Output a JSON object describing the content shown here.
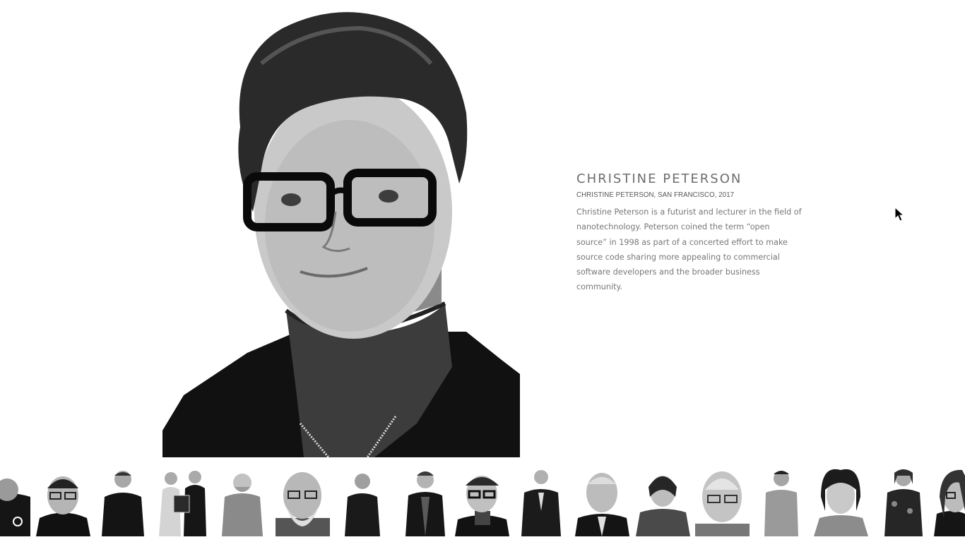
{
  "featured": {
    "name": "CHRISTINE PETERSON",
    "caption": "CHRISTINE PETERSON, SAN FRANCISCO, 2017",
    "description": "Christine Peterson is a futurist and lecturer in the field of nanotechnology. Peterson coined the term “open source” in 1998 as part of a concerted effort to make source code sharing more appealing to commercial software developers and the broader business community."
  },
  "thumbnails": [
    {
      "name": "thumbnail-portrait-1"
    },
    {
      "name": "thumbnail-portrait-2"
    },
    {
      "name": "thumbnail-portrait-3"
    },
    {
      "name": "thumbnail-portrait-4"
    },
    {
      "name": "thumbnail-portrait-5"
    },
    {
      "name": "thumbnail-portrait-6"
    },
    {
      "name": "thumbnail-portrait-7"
    },
    {
      "name": "thumbnail-portrait-8"
    },
    {
      "name": "thumbnail-portrait-9"
    },
    {
      "name": "thumbnail-portrait-10"
    },
    {
      "name": "thumbnail-portrait-11"
    },
    {
      "name": "thumbnail-portrait-12"
    },
    {
      "name": "thumbnail-portrait-13"
    },
    {
      "name": "thumbnail-portrait-14"
    },
    {
      "name": "thumbnail-portrait-15"
    },
    {
      "name": "thumbnail-portrait-16"
    },
    {
      "name": "thumbnail-portrait-17"
    }
  ]
}
